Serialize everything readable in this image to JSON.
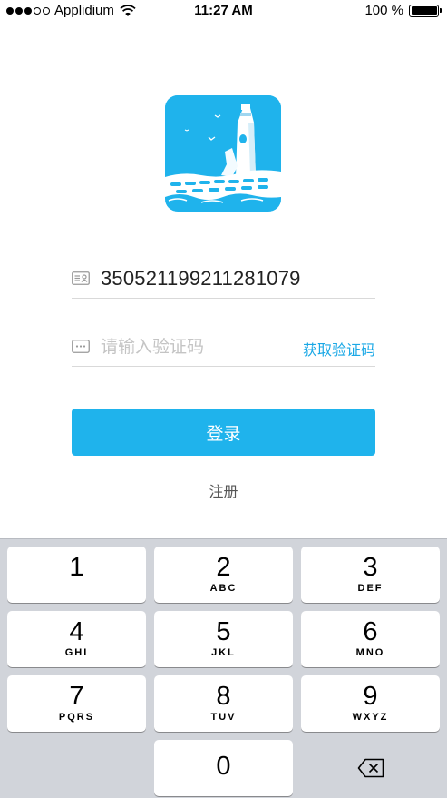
{
  "status_bar": {
    "carrier": "Applidium",
    "time": "11:27 AM",
    "battery": "100 %"
  },
  "login": {
    "id_number": "350521199211281079",
    "code_placeholder": "请输入验证码",
    "get_code_label": "获取验证码",
    "login_label": "登录",
    "register_label": "注册"
  },
  "keypad": {
    "keys": [
      {
        "num": "1",
        "letters": ""
      },
      {
        "num": "2",
        "letters": "ABC"
      },
      {
        "num": "3",
        "letters": "DEF"
      },
      {
        "num": "4",
        "letters": "GHI"
      },
      {
        "num": "5",
        "letters": "JKL"
      },
      {
        "num": "6",
        "letters": "MNO"
      },
      {
        "num": "7",
        "letters": "PQRS"
      },
      {
        "num": "8",
        "letters": "TUV"
      },
      {
        "num": "9",
        "letters": "WXYZ"
      },
      {
        "num": "0",
        "letters": ""
      }
    ]
  },
  "colors": {
    "accent": "#1fb3ec",
    "link": "#1aa8e6",
    "keypad_bg": "#d1d4da"
  }
}
